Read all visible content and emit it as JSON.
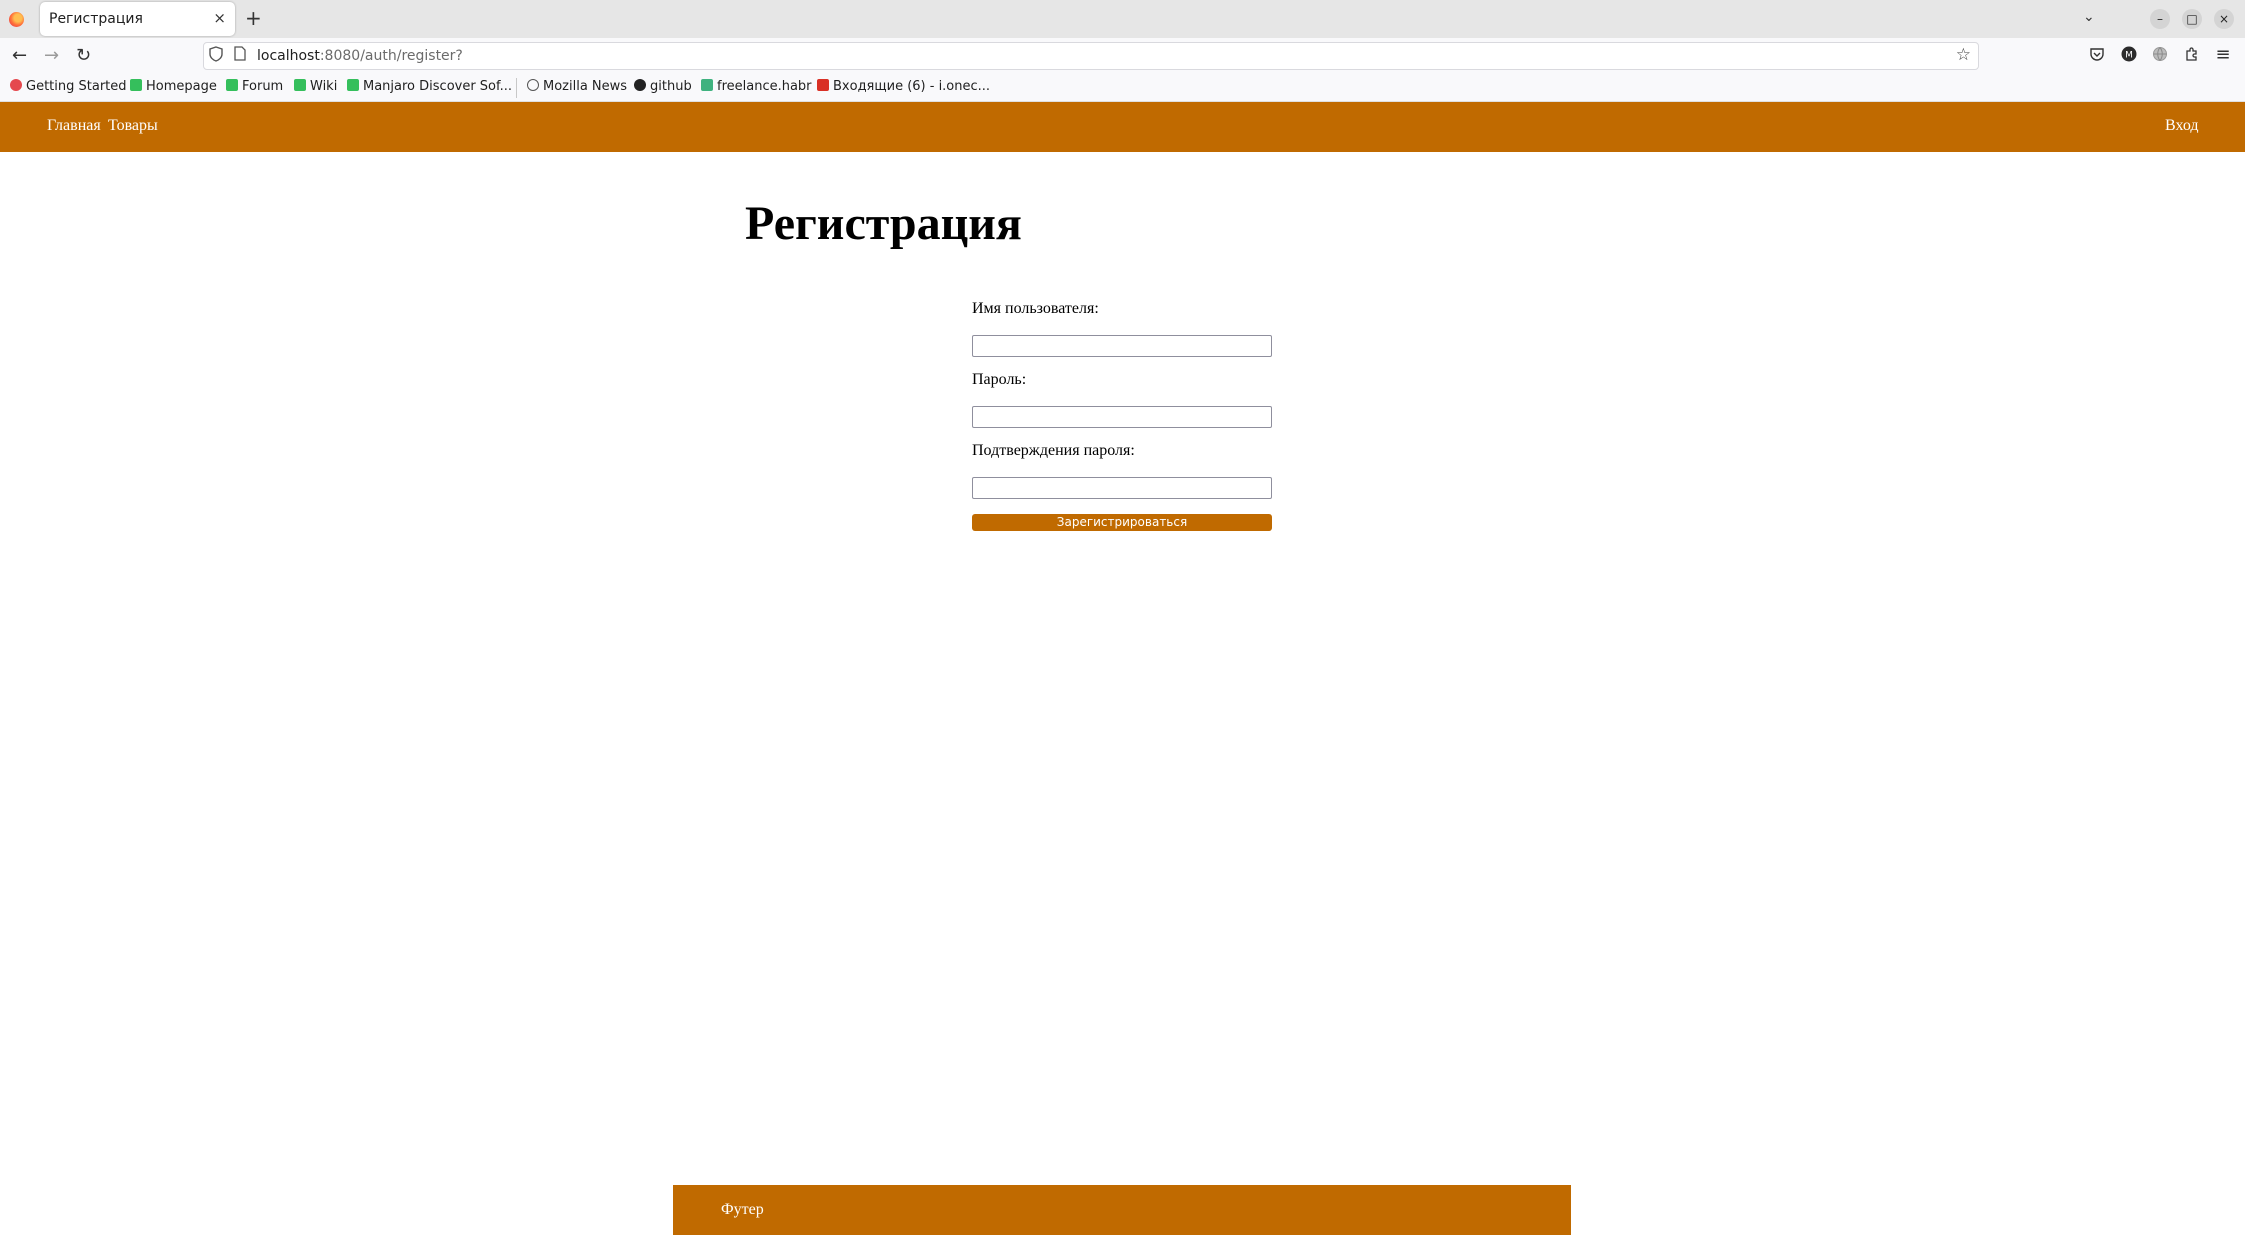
{
  "browser": {
    "tab_title": "Регистрация",
    "tab_close": "×",
    "new_tab": "+",
    "url_host": "localhost",
    "url_path": ":8080/auth/register?",
    "icons": {
      "back": "←",
      "forward": "→",
      "reload": "↻",
      "star": "☆",
      "tab_list": "⌄",
      "minimize": "–",
      "maximize": "□",
      "close": "×",
      "menu": "≡"
    },
    "bookmarks": [
      {
        "label": "Getting Started",
        "color": "#e5484d"
      },
      {
        "label": "Homepage",
        "color": "#35bf5c"
      },
      {
        "label": "Forum",
        "color": "#35bf5c"
      },
      {
        "label": "Wiki",
        "color": "#35bf5c"
      },
      {
        "label": "Manjaro Discover Sof...",
        "color": "#35bf5c"
      },
      {
        "label": "Mozilla News",
        "color": "#555555"
      },
      {
        "label": "github",
        "color": "#222222"
      },
      {
        "label": "freelance.habr",
        "color": "#3fb27f"
      },
      {
        "label": "Входящие (6) - i.onec...",
        "color": "#d93025"
      }
    ]
  },
  "header": {
    "nav_home": "Главная",
    "nav_products": "Товары",
    "login": "Вход",
    "brand_color": "#c06a00"
  },
  "page": {
    "title": "Регистрация"
  },
  "form": {
    "username_label": "Имя пользователя:",
    "username_value": "",
    "password_label": "Пароль:",
    "password_value": "",
    "confirm_label": "Подтверждения пароля:",
    "confirm_value": "",
    "submit_label": "Зарегистрироваться"
  },
  "footer": {
    "text": "Футер"
  }
}
